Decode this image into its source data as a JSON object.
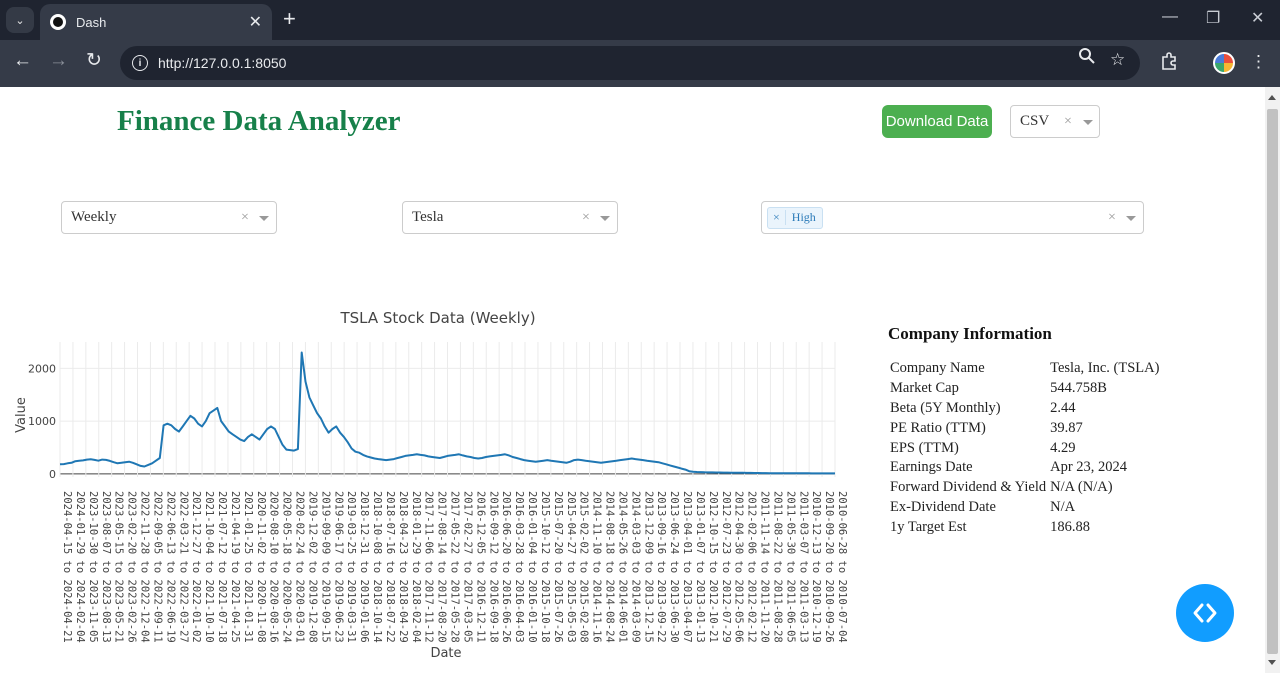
{
  "browser": {
    "tab_title": "Dash",
    "url": "http://127.0.0.1:8050",
    "new_tab_label": "+",
    "tab_close_label": "✕",
    "menu_chevron": "⌄"
  },
  "header": {
    "title": "Finance Data Analyzer",
    "download_label": "Download Data",
    "format_selected": "CSV"
  },
  "controls": {
    "interval_selected": "Weekly",
    "company_selected": "Tesla",
    "metrics_selected": [
      "High"
    ]
  },
  "chart_data": {
    "type": "line",
    "title": "TSLA Stock Data (Weekly)",
    "xlabel": "Date",
    "ylabel": "Value",
    "ylim": [
      -60,
      2500
    ],
    "yticks": [
      0,
      1000,
      2000
    ],
    "grid": true,
    "x_order": "newest-first",
    "series": [
      {
        "name": "High",
        "color": "#1f77b4",
        "x_range": [
          "2024-04-15",
          "2010-06-28"
        ],
        "values": [
          180,
          185,
          200,
          210,
          240,
          250,
          255,
          270,
          275,
          265,
          250,
          270,
          265,
          245,
          220,
          200,
          210,
          220,
          230,
          210,
          180,
          150,
          140,
          170,
          200,
          250,
          300,
          920,
          950,
          920,
          850,
          800,
          900,
          1000,
          1100,
          1050,
          950,
          900,
          1000,
          1150,
          1200,
          1250,
          1000,
          900,
          800,
          750,
          700,
          650,
          620,
          700,
          750,
          700,
          650,
          750,
          850,
          900,
          850,
          700,
          550,
          460,
          450,
          440,
          470,
          2300,
          1750,
          1450,
          1300,
          1150,
          1050,
          900,
          780,
          850,
          900,
          780,
          700,
          600,
          480,
          420,
          400,
          360,
          330,
          310,
          290,
          280,
          270,
          260,
          270,
          280,
          300,
          320,
          340,
          350,
          360,
          370,
          360,
          350,
          330,
          320,
          310,
          300,
          320,
          340,
          350,
          360,
          370,
          350,
          330,
          320,
          300,
          290,
          300,
          320,
          330,
          340,
          350,
          360,
          370,
          350,
          320,
          300,
          280,
          260,
          250,
          240,
          230,
          240,
          250,
          260,
          250,
          240,
          230,
          220,
          210,
          230,
          260,
          270,
          260,
          250,
          240,
          230,
          220,
          210,
          220,
          230,
          240,
          250,
          260,
          270,
          280,
          290,
          280,
          270,
          260,
          250,
          240,
          230,
          220,
          200,
          180,
          160,
          140,
          120,
          100,
          80,
          50,
          40,
          35,
          32,
          30,
          28,
          27,
          26,
          25,
          24,
          23,
          22,
          21,
          20,
          19,
          18,
          17,
          16,
          15,
          14,
          14,
          13,
          13,
          12,
          12,
          11,
          11,
          11,
          10,
          10,
          10,
          10,
          9,
          9,
          9,
          9,
          8,
          8,
          8
        ]
      }
    ],
    "x_tick_labels": [
      "2024-04-15 to 2024-04-21",
      "2024-01-29 to 2024-02-04",
      "2023-10-30 to 2023-11-05",
      "2023-08-07 to 2023-08-13",
      "2023-05-15 to 2023-05-21",
      "2023-02-20 to 2023-02-26",
      "2022-11-28 to 2022-12-04",
      "2022-09-05 to 2022-09-11",
      "2022-06-13 to 2022-06-19",
      "2022-03-21 to 2022-03-27",
      "2021-12-27 to 2022-01-02",
      "2021-10-04 to 2021-10-10",
      "2021-07-12 to 2021-07-18",
      "2021-04-19 to 2021-04-25",
      "2021-01-25 to 2021-01-31",
      "2020-11-02 to 2020-11-08",
      "2020-08-10 to 2020-08-16",
      "2020-05-18 to 2020-05-24",
      "2020-02-24 to 2020-03-01",
      "2019-12-02 to 2019-12-08",
      "2019-09-09 to 2019-09-15",
      "2019-06-17 to 2019-06-23",
      "2019-03-25 to 2019-03-31",
      "2018-12-31 to 2019-01-06",
      "2018-10-08 to 2018-10-14",
      "2018-07-16 to 2018-07-22",
      "2018-04-23 to 2018-04-29",
      "2018-01-29 to 2018-02-04",
      "2017-11-06 to 2017-11-12",
      "2017-08-14 to 2017-08-20",
      "2017-05-22 to 2017-05-28",
      "2017-02-27 to 2017-03-05",
      "2016-12-05 to 2016-12-11",
      "2016-09-12 to 2016-09-18",
      "2016-06-20 to 2016-06-26",
      "2016-03-28 to 2016-04-03",
      "2016-01-04 to 2016-01-10",
      "2015-10-12 to 2015-10-18",
      "2015-07-20 to 2015-07-26",
      "2015-04-27 to 2015-05-03",
      "2015-02-02 to 2015-02-08",
      "2014-11-10 to 2014-11-16",
      "2014-08-18 to 2014-08-24",
      "2014-05-26 to 2014-06-01",
      "2014-03-03 to 2014-03-09",
      "2013-12-09 to 2013-12-15",
      "2013-09-16 to 2013-09-22",
      "2013-06-24 to 2013-06-30",
      "2013-04-01 to 2013-04-07",
      "2013-01-07 to 2013-01-13",
      "2012-10-15 to 2012-10-21",
      "2012-07-23 to 2012-07-29",
      "2012-04-30 to 2012-05-06",
      "2012-02-06 to 2012-02-12",
      "2011-11-14 to 2011-11-20",
      "2011-08-22 to 2011-08-28",
      "2011-05-30 to 2011-06-05",
      "2011-03-07 to 2011-03-13",
      "2010-12-13 to 2010-12-19",
      "2010-09-20 to 2010-09-26",
      "2010-06-28 to 2010-07-04"
    ]
  },
  "company_info": {
    "title": "Company Information",
    "rows": [
      {
        "label": "Company Name",
        "value": "Tesla, Inc. (TSLA)"
      },
      {
        "label": "Market Cap",
        "value": "544.758B"
      },
      {
        "label": "Beta (5Y Monthly)",
        "value": "2.44"
      },
      {
        "label": "PE Ratio (TTM)",
        "value": "39.87"
      },
      {
        "label": "EPS (TTM)",
        "value": "4.29"
      },
      {
        "label": "Earnings Date",
        "value": "Apr 23, 2024"
      },
      {
        "label": "Forward Dividend & Yield",
        "value": "N/A (N/A)"
      },
      {
        "label": "Ex-Dividend Date",
        "value": "N/A"
      },
      {
        "label": "1y Target Est",
        "value": "186.88"
      }
    ]
  },
  "icons": {
    "fab": "code-icon",
    "accent": "#119dff",
    "title_color": "#17804a",
    "download_color": "#4caf50"
  }
}
